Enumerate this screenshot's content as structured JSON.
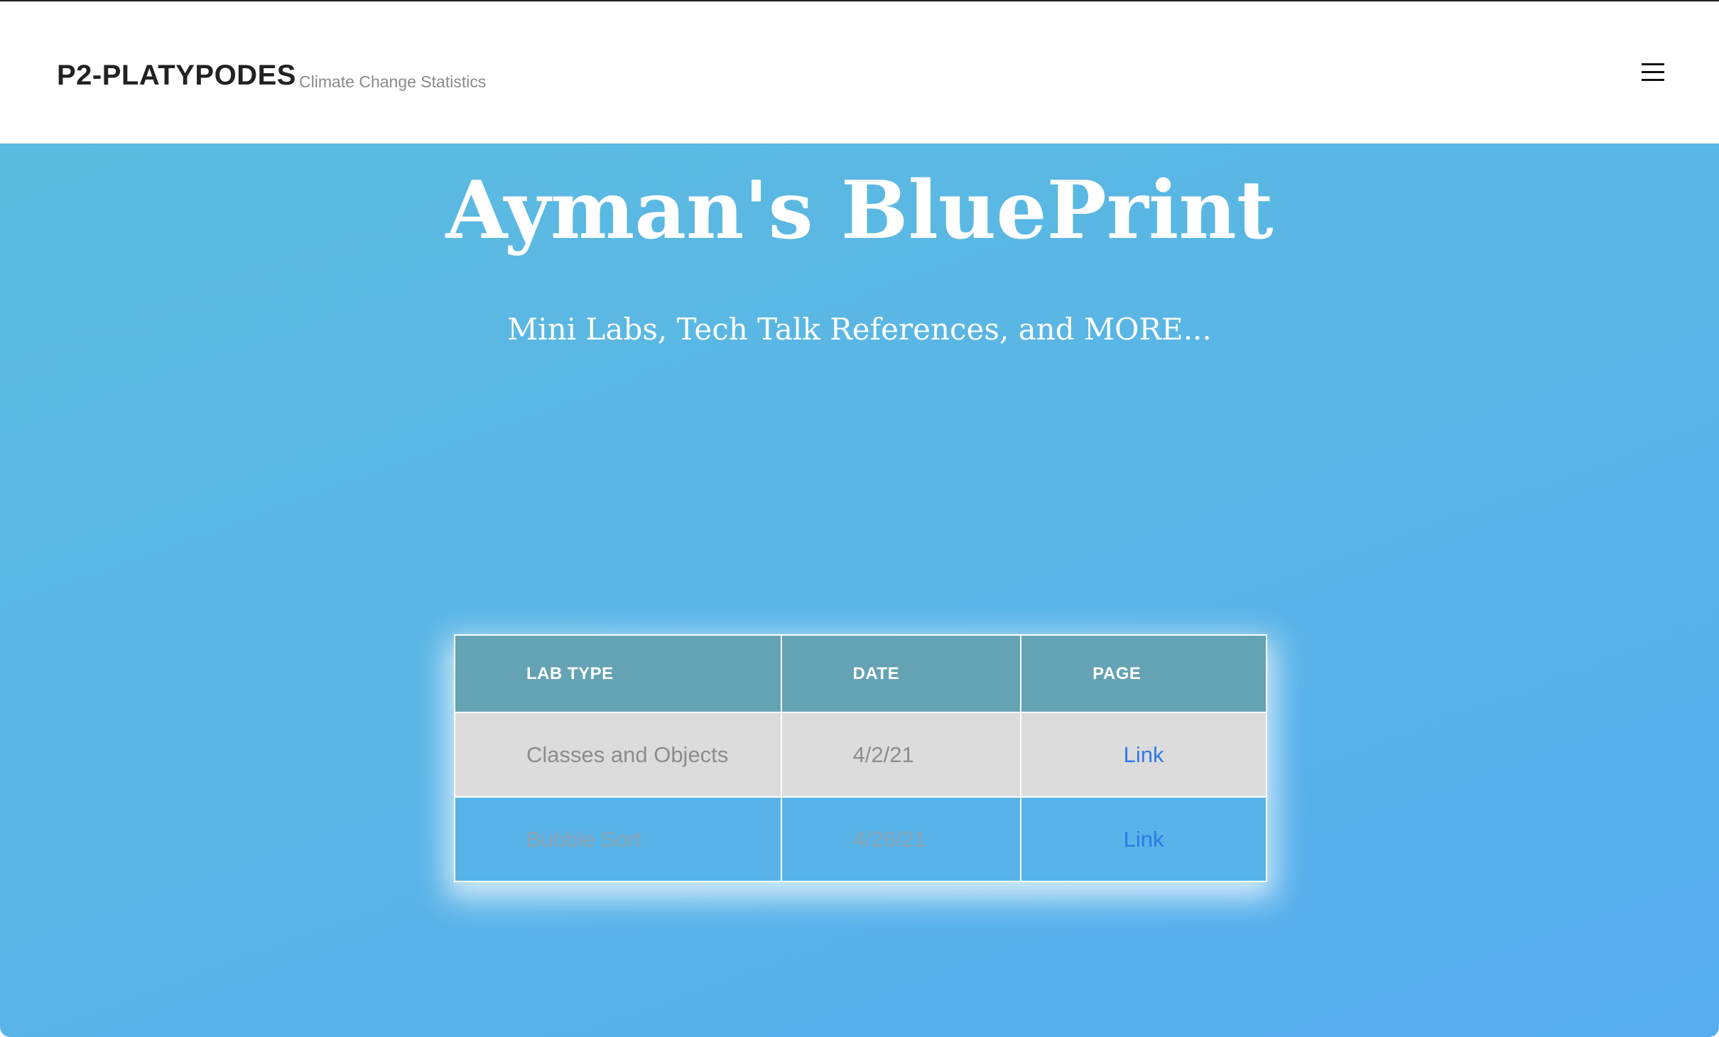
{
  "header": {
    "brand": "P2-PLATYPODES",
    "tagline": "Climate Change Statistics",
    "menu_icon": "hamburger-menu-icon"
  },
  "hero": {
    "title": "Ayman's BluePrint",
    "subtitle": "Mini Labs, Tech Talk References, and MORE..."
  },
  "table": {
    "columns": [
      "LAB TYPE",
      "DATE",
      "PAGE"
    ],
    "rows": [
      {
        "lab_type": "Classes and Objects",
        "date": "4/2/21",
        "page": "Link"
      },
      {
        "lab_type": "Bubble Sort",
        "date": "4/26/21",
        "page": "Link"
      }
    ]
  },
  "colors": {
    "header_bg": "#ffffff",
    "hero_gradient_start": "#5bbbe0",
    "hero_gradient_end": "#57adf0",
    "table_header_bg": "#63a3b4",
    "row_a_bg": "#dcdcdc",
    "row_b_bg": "#58b4e8",
    "link": "#2e78e8"
  }
}
